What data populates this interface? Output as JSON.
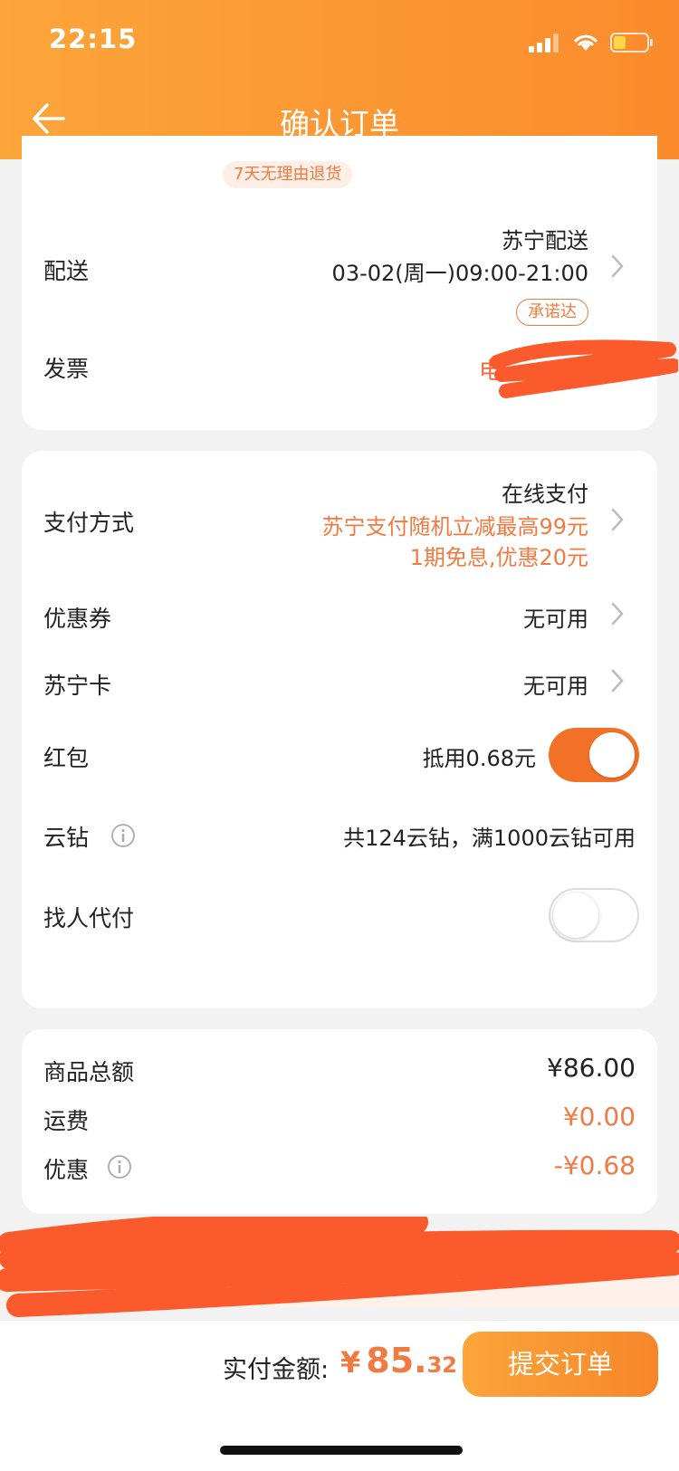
{
  "status_bar": {
    "time": "22:15"
  },
  "header": {
    "title": "确认订单"
  },
  "colors": {
    "accent": "#f07b42",
    "header": "#fca53a",
    "toggle_on": "#f27127"
  },
  "product": {
    "return_tag": "7天无理由退货"
  },
  "delivery": {
    "label": "配送",
    "carrier": "苏宁配送",
    "time": "03-02(周一)09:00-21:00",
    "badge": "承诺达"
  },
  "invoice": {
    "label": "发票",
    "value_visible": "电"
  },
  "payment": {
    "label": "支付方式",
    "method": "在线支付",
    "promo1": "苏宁支付随机立减最高99元",
    "promo2": "1期免息,优惠20元"
  },
  "coupon": {
    "label": "优惠券",
    "value": "无可用"
  },
  "suning_card": {
    "label": "苏宁卡",
    "value": "无可用"
  },
  "red_packet": {
    "label": "红包",
    "value": "抵用0.68元",
    "enabled": true
  },
  "cloud_diamond": {
    "label": "云钻",
    "value": "共124云钻，满1000云钻可用",
    "icon": "info-icon"
  },
  "proxy_pay": {
    "label": "找人代付",
    "enabled": false
  },
  "summary": {
    "subtotal_label": "商品总额",
    "subtotal": "¥86.00",
    "shipping_label": "运费",
    "shipping": "¥0.00",
    "discount_label": "优惠",
    "discount": "-¥0.68"
  },
  "footer": {
    "pay_label": "实付金额:",
    "currency": "¥",
    "amount_int": "85.",
    "amount_dec": "32",
    "submit": "提交订单"
  }
}
